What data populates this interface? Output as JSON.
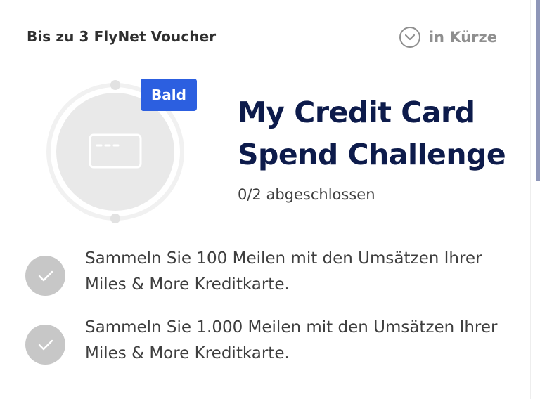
{
  "header": {
    "reward": "Bis zu 3 FlyNet Voucher",
    "status": "in Kürze",
    "status_icon": "chevron-down-circle-icon"
  },
  "badge": {
    "label": "Bald",
    "icon": "credit-card-icon",
    "badge_color": "#2c5fe0"
  },
  "challenge": {
    "title": "My Credit Card Spend Challenge",
    "progress": "0/2 abgeschlossen",
    "title_color": "#0d1b4b"
  },
  "tasks": [
    {
      "text": "Sammeln Sie 100 Meilen mit den Umsätzen Ihrer Miles & More Kreditkarte.",
      "icon": "check-icon"
    },
    {
      "text": "Sammeln Sie 1.000 Meilen mit den Umsätzen Ihrer Miles & More Kreditkarte.",
      "icon": "check-icon"
    }
  ]
}
